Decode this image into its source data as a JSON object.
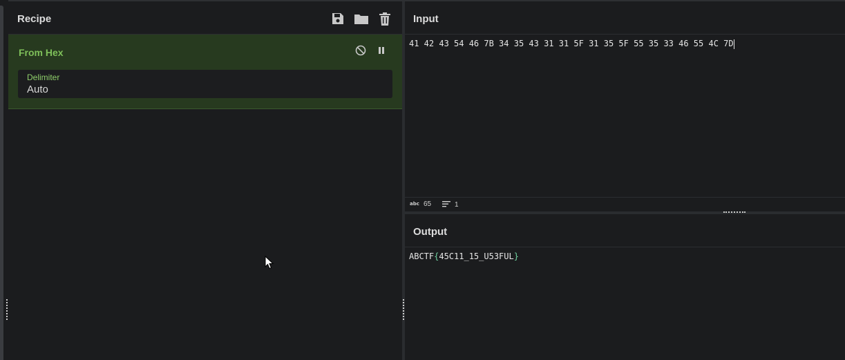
{
  "recipe": {
    "title": "Recipe",
    "icons": [
      "save-icon",
      "folder-icon",
      "trash-icon"
    ],
    "operation": {
      "name": "From Hex",
      "icons": [
        "disable-icon",
        "pause-icon"
      ],
      "argument": {
        "label": "Delimiter",
        "value": "Auto"
      }
    }
  },
  "input": {
    "title": "Input",
    "text": "41 42 43 54 46 7B 34 35 43 31 31 5F 31 35 5F 55 35 33 46 55 4C 7D",
    "status": {
      "length_icon": "abc-icon",
      "length": "65",
      "lines_icon": "lines-icon",
      "lines": "1"
    }
  },
  "output": {
    "title": "Output",
    "text_prefix": "ABCTF",
    "brace_open": "{",
    "text_middle": "45C11_15_U53FUL",
    "brace_close": "}"
  },
  "colors": {
    "operation_bg": "#273a1f",
    "operation_text": "#7fc05a",
    "background": "#1b1c1e"
  }
}
